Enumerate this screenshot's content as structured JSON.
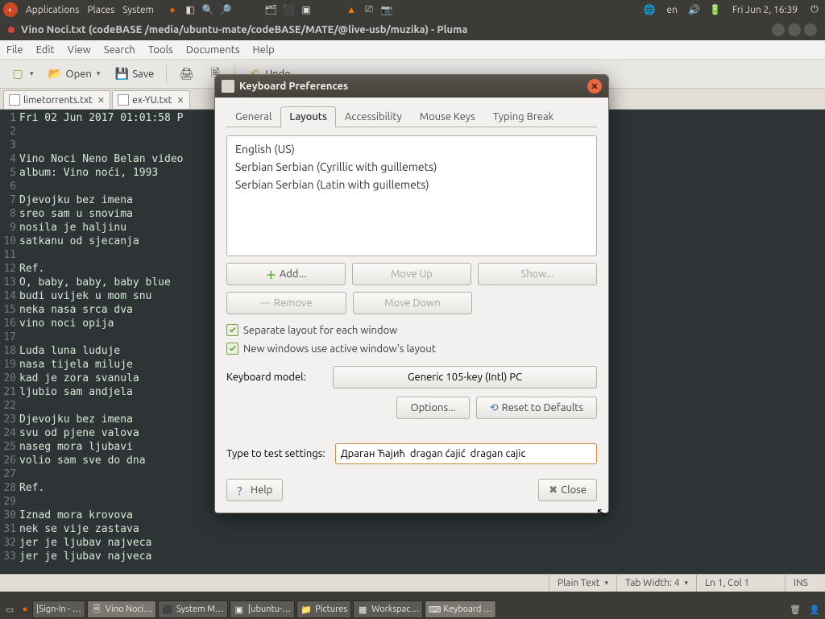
{
  "panel": {
    "menus": [
      "Applications",
      "Places",
      "System"
    ],
    "lang": "en",
    "clock": "Fri Jun  2, 16:39"
  },
  "pluma": {
    "title": "Vino Noci.txt (codeBASE /media/ubuntu-mate/codeBASE/MATE/@live-usb/muzika) - Pluma",
    "menus": [
      "File",
      "Edit",
      "View",
      "Search",
      "Tools",
      "Documents",
      "Help"
    ],
    "toolbar": {
      "open": "Open",
      "save": "Save",
      "undo": "Undo"
    },
    "tabs": [
      {
        "label": "limetorrents.txt"
      },
      {
        "label": "ex-YU.txt"
      }
    ],
    "lines": [
      "Fri 02 Jun 2017 01:01:58 P",
      "",
      "",
      "Vino Noci Neno Belan video",
      "album: Vino noći, 1993",
      "",
      "Djevojku bez imena",
      "sreo sam u snovima",
      "nosila je haljinu",
      "satkanu od sjecanja",
      "",
      "Ref.",
      "O, baby, baby, baby blue",
      "budi uvijek u mom snu",
      "neka nasa srca dva",
      "vino noci opija",
      "",
      "Luda luna luduje",
      "nasa tijela miluje",
      "kad je zora svanula",
      "ljubio sam andjela",
      "",
      "Djevojku bez imena",
      "svu od pjene valova",
      "naseg mora ljubavi",
      "volio sam sve do dna",
      "",
      "Ref.",
      "",
      "Iznad mora krovova",
      "nek se vije zastava",
      "jer je ljubav najveca",
      "jer je ljubav najveca"
    ],
    "status": {
      "plain": "Plain Text",
      "tabwidth": "Tab Width: 4",
      "pos": "Ln 1, Col 1",
      "ins": "INS"
    }
  },
  "dialog": {
    "title": "Keyboard Preferences",
    "tabs": [
      "General",
      "Layouts",
      "Accessibility",
      "Mouse Keys",
      "Typing Break"
    ],
    "active_tab": 1,
    "layouts": [
      "English (US)",
      "Serbian Serbian (Cyrillic with guillemets)",
      "Serbian Serbian (Latin with guillemets)"
    ],
    "buttons": {
      "add": "Add...",
      "moveup": "Move Up",
      "show": "Show...",
      "remove": "Remove",
      "movedown": "Move Down",
      "options": "Options...",
      "reset": "Reset to Defaults",
      "help": "Help",
      "close": "Close"
    },
    "chk1": "Separate layout for each window",
    "chk2": "New windows use active window's layout",
    "model_label": "Keyboard model:",
    "model_value": "Generic 105-key (Intl) PC",
    "test_label": "Type to test settings:",
    "test_value": "Драган Ћајић  dragan ćajić  dragan cajic"
  },
  "taskbar": [
    "[Sign-In - …",
    "Vino Noci…",
    "System M…",
    "[ubuntu-…",
    "Pictures",
    "Workspac…",
    "Keyboard …"
  ]
}
